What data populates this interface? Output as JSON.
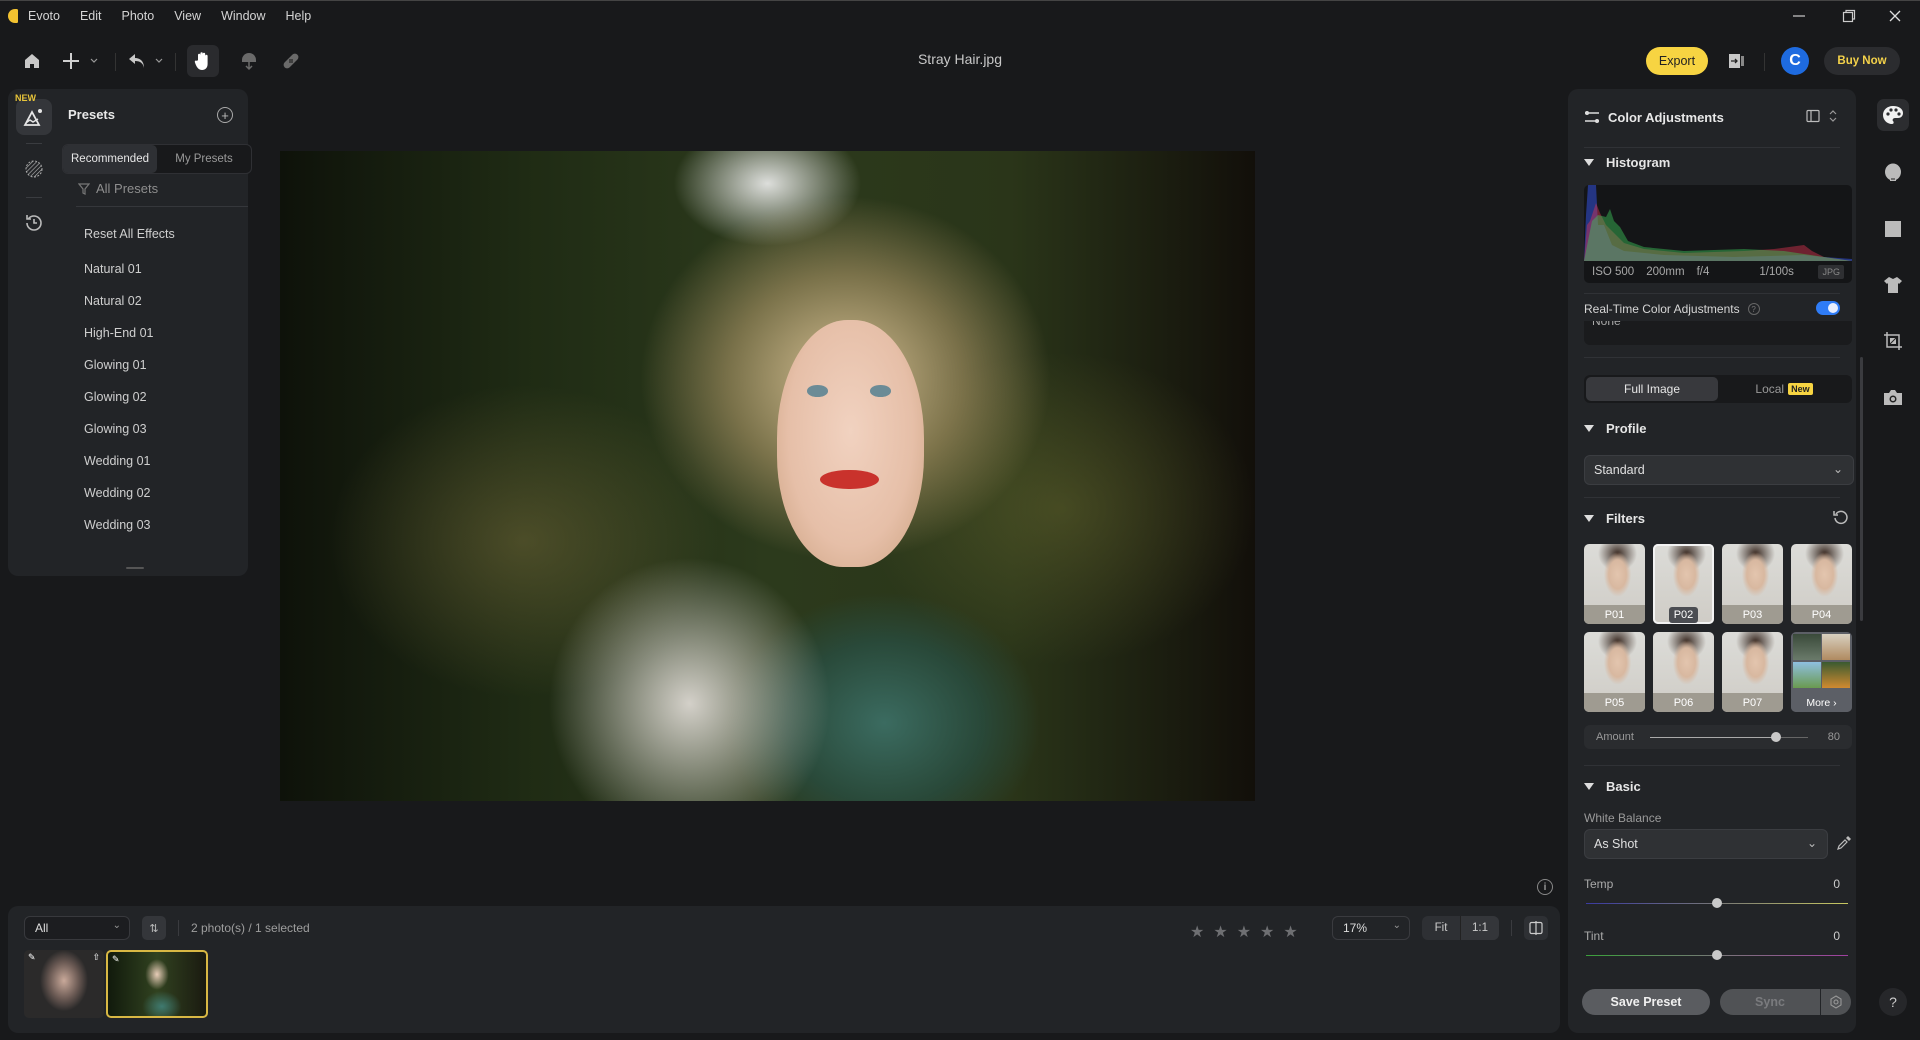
{
  "menubar": {
    "app_name": "Evoto",
    "items": [
      "Edit",
      "Photo",
      "View",
      "Window",
      "Help"
    ]
  },
  "toolbar": {
    "document_title": "Stray Hair.jpg",
    "export_label": "Export",
    "avatar_initial": "C",
    "buy_label": "Buy Now",
    "tools": [
      "home-icon",
      "add-icon",
      "undo-icon",
      "hand-icon",
      "stamp-icon",
      "bandage-icon"
    ],
    "active_tool": "hand-icon"
  },
  "left_panel": {
    "new_tag": "NEW",
    "title": "Presets",
    "tabs": [
      {
        "label": "Recommended",
        "active": true
      },
      {
        "label": "My Presets",
        "active": false
      }
    ],
    "filter_label": "All Presets",
    "reset_label": "Reset All Effects",
    "presets": [
      "Natural 01",
      "Natural 02",
      "High-End 01",
      "Glowing 01",
      "Glowing 02",
      "Glowing 03",
      "Wedding 01",
      "Wedding 02",
      "Wedding 03"
    ]
  },
  "filmstrip": {
    "filter_value": "All",
    "count_text": "2 photo(s) / 1 selected",
    "rating": 0,
    "max_rating": 5,
    "zoom_value": "17%",
    "fit_label": "Fit",
    "one_to_one_label": "1:1",
    "selected_index": 1
  },
  "right_panel": {
    "title": "Color Adjustments",
    "histogram": {
      "title": "Histogram",
      "iso": "ISO 500",
      "focal": "200mm",
      "aperture": "f/4",
      "shutter": "1/100s",
      "format": "JPG"
    },
    "realtime": {
      "label": "Real-Time Color Adjustments",
      "enabled": true,
      "dropdown_value": "None"
    },
    "scope_tabs": [
      {
        "label": "Full Image",
        "active": true
      },
      {
        "label": "Local",
        "active": false,
        "badge": "New"
      }
    ],
    "profile": {
      "title": "Profile",
      "value": "Standard"
    },
    "filters": {
      "title": "Filters",
      "items": [
        "P01",
        "P02",
        "P03",
        "P04",
        "P05",
        "P06",
        "P07"
      ],
      "selected": "P02",
      "more_label": "More ›",
      "amount_label": "Amount",
      "amount_value": "80",
      "amount_fraction": 0.8
    },
    "basic": {
      "title": "Basic",
      "white_balance_label": "White Balance",
      "white_balance_value": "As Shot",
      "temp_label": "Temp",
      "temp_value": "0",
      "tint_label": "Tint",
      "tint_value": "0"
    },
    "save_preset_label": "Save Preset",
    "sync_label": "Sync"
  },
  "right_rail": {
    "items": [
      "palette-icon",
      "face-icon",
      "background-icon",
      "clothing-icon",
      "crop-icon",
      "camera-icon"
    ],
    "active": "palette-icon",
    "help_label": "?"
  },
  "colors": {
    "accent_yellow": "#f7d442",
    "accent_blue": "#2f7cf6",
    "avatar_blue": "#1e6be0"
  }
}
